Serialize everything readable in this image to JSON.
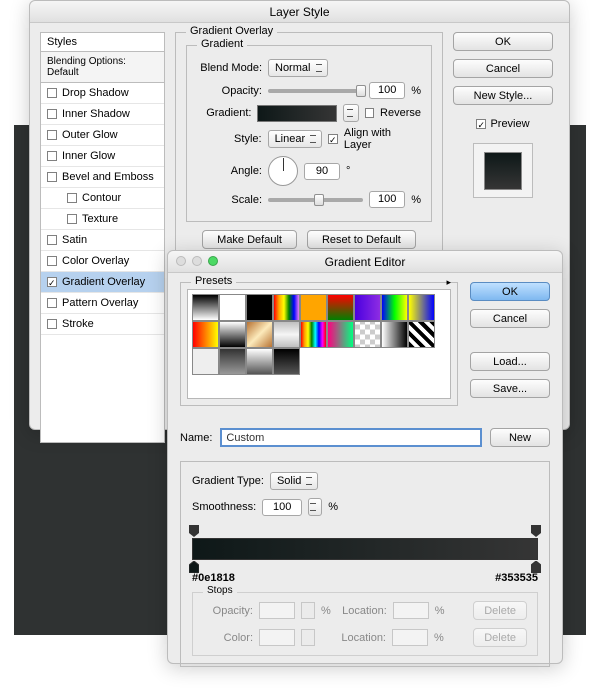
{
  "layerStyle": {
    "title": "Layer Style",
    "stylesHeader": "Styles",
    "blendingDefault": "Blending Options: Default",
    "items": [
      {
        "label": "Drop Shadow",
        "checked": false
      },
      {
        "label": "Inner Shadow",
        "checked": false
      },
      {
        "label": "Outer Glow",
        "checked": false
      },
      {
        "label": "Inner Glow",
        "checked": false
      },
      {
        "label": "Bevel and Emboss",
        "checked": false
      },
      {
        "label": "Contour",
        "checked": false,
        "indent": true
      },
      {
        "label": "Texture",
        "checked": false,
        "indent": true
      },
      {
        "label": "Satin",
        "checked": false
      },
      {
        "label": "Color Overlay",
        "checked": false
      },
      {
        "label": "Gradient Overlay",
        "checked": true,
        "selected": true
      },
      {
        "label": "Pattern Overlay",
        "checked": false
      },
      {
        "label": "Stroke",
        "checked": false
      }
    ],
    "panelTitle": "Gradient Overlay",
    "gradientTitle": "Gradient",
    "labels": {
      "blendMode": "Blend Mode:",
      "opacity": "Opacity:",
      "gradient": "Gradient:",
      "style": "Style:",
      "angle": "Angle:",
      "scale": "Scale:"
    },
    "blendMode": "Normal",
    "opacity": "100",
    "opacityUnit": "%",
    "reverse": "Reverse",
    "styleVal": "Linear",
    "alignCb": "Align with Layer",
    "angle": "90",
    "angleUnit": "°",
    "scale": "100",
    "scaleUnit": "%",
    "makeDefault": "Make Default",
    "resetDefault": "Reset to Default",
    "ok": "OK",
    "cancel": "Cancel",
    "newStyle": "New Style...",
    "preview": "Preview"
  },
  "ge": {
    "title": "Gradient Editor",
    "presets": "Presets",
    "ok": "OK",
    "cancel": "Cancel",
    "load": "Load...",
    "save": "Save...",
    "nameLbl": "Name:",
    "name": "Custom",
    "newBtn": "New",
    "gradTypeLbl": "Gradient Type:",
    "gradType": "Solid",
    "smoothnessLbl": "Smoothness:",
    "smoothness": "100",
    "smoothUnit": "%",
    "leftHex": "#0e1818",
    "rightHex": "#353535",
    "stopsTitle": "Stops",
    "opacityLbl": "Opacity:",
    "locationLbl": "Location:",
    "colorLbl": "Color:",
    "pct": "%",
    "delete": "Delete"
  },
  "presetSwatches": [
    "linear-gradient(#000,#fff)",
    "linear-gradient(#fff,#fff)",
    "linear-gradient(#000,#000)",
    "linear-gradient(90deg,red,orange,yellow,green,blue,violet)",
    "linear-gradient(orange,orange)",
    "linear-gradient(red,green)",
    "linear-gradient(90deg,#4a00e0,#8e2de2)",
    "linear-gradient(90deg,#00f,#0f0,#ff0)",
    "linear-gradient(90deg,#ff0,#00f)",
    "linear-gradient(90deg,#f00,#ff0)",
    "linear-gradient(#fff,#000)",
    "linear-gradient(135deg,#b87333,#fceabb,#b87333)",
    "linear-gradient(#c0c0c0,#f5f5f5,#c0c0c0)",
    "linear-gradient(90deg,red,orange,yellow,green,cyan,blue,magenta,red)",
    "linear-gradient(90deg,#ff0080,#00ff80)",
    "repeating-conic-gradient(#ccc 0 25%, #fff 0 50%) 0/10px 10px",
    "linear-gradient(90deg,rgba(0,0,0,0),#000)",
    "repeating-linear-gradient(45deg,#000 0 4px,#fff 4px 8px)",
    "linear-gradient(#eee,#eee)",
    "linear-gradient(#333,#999)",
    "linear-gradient(#fff,#555)",
    "linear-gradient(#000,#555)"
  ]
}
